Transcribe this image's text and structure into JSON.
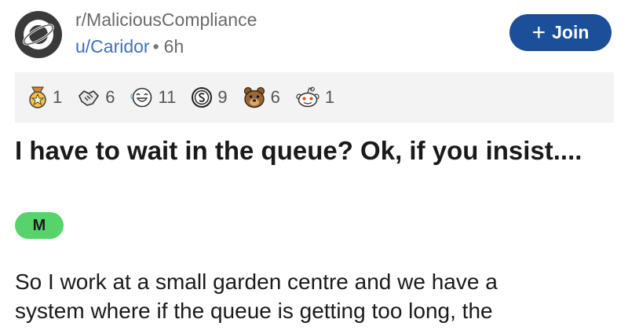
{
  "post": {
    "subreddit": "r/MaliciousCompliance",
    "author": "u/Caridor",
    "separator": "•",
    "age": "6h",
    "join_plus": "+",
    "join_label": "Join",
    "awards": [
      {
        "icon": "gold-medal-icon",
        "count": "1"
      },
      {
        "icon": "handshake-icon",
        "count": "6"
      },
      {
        "icon": "laughing-face-icon",
        "count": "11"
      },
      {
        "icon": "silver-coin-icon",
        "count": "9"
      },
      {
        "icon": "bear-icon",
        "count": "6"
      },
      {
        "icon": "snoo-icon",
        "count": "1"
      }
    ],
    "title": "I have to wait in the queue? Ok, if you insist....",
    "flair": "M",
    "body_lines": [
      "So I work at a small garden centre and we have a",
      "system where if the queue is getting too long, the"
    ]
  },
  "colors": {
    "join_button": "#1b4f99",
    "author_link": "#3d6fb5",
    "flair_bg": "#56d36a",
    "awards_bg": "#f3f3f3"
  }
}
